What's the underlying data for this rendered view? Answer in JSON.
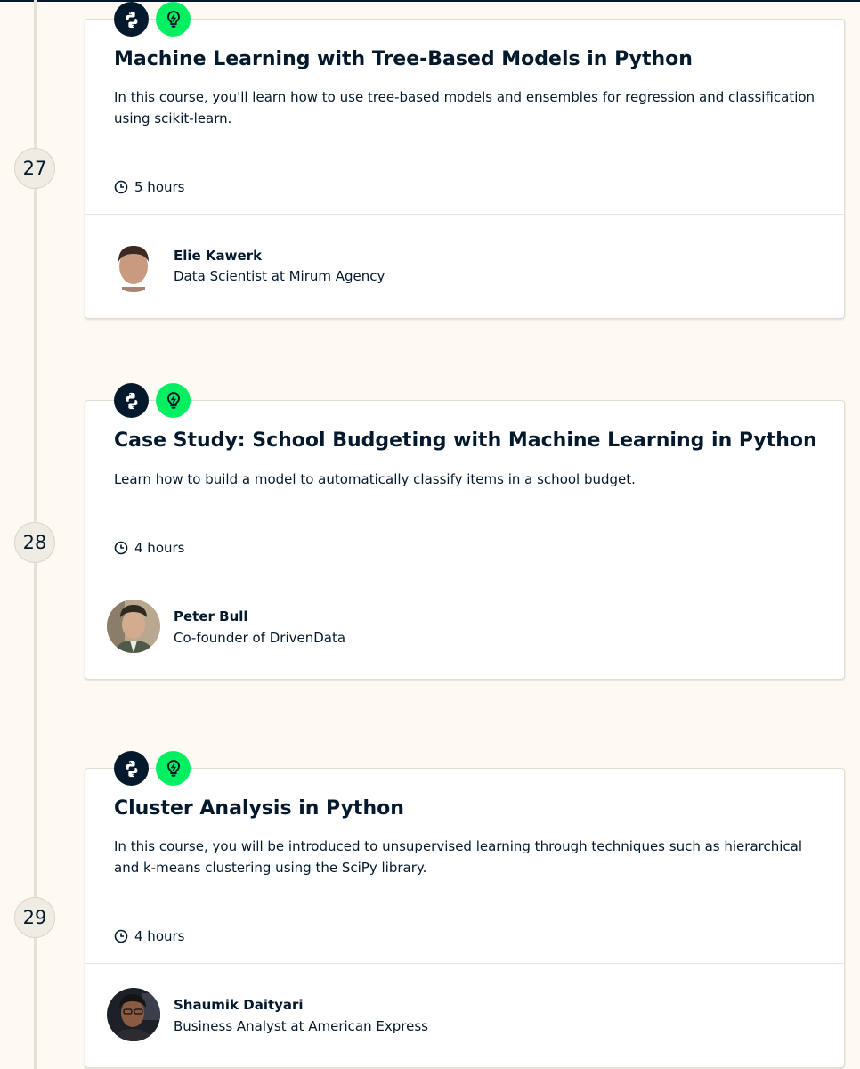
{
  "colors": {
    "background": "#fcfaf2",
    "navy": "#05192d",
    "brand_green": "#03ef62",
    "timeline": "#e6e2d6"
  },
  "courses": [
    {
      "step": "27",
      "tech_icon": "python-icon",
      "topic_icon": "lightbulb-icon",
      "title": "Machine Learning with Tree-Based Models in Python",
      "description": "In this course, you'll learn how to use tree-based models and ensembles for regression and classification using scikit-learn.",
      "duration": "5 hours",
      "instructor": {
        "name": "Elie Kawerk",
        "role": "Data Scientist at Mirum Agency"
      }
    },
    {
      "step": "28",
      "tech_icon": "python-icon",
      "topic_icon": "lightbulb-icon",
      "title": "Case Study: School Budgeting with Machine Learning in Python",
      "description": "Learn how to build a model to automatically classify items in a school budget.",
      "duration": "4 hours",
      "instructor": {
        "name": "Peter Bull",
        "role": "Co-founder of DrivenData"
      }
    },
    {
      "step": "29",
      "tech_icon": "python-icon",
      "topic_icon": "lightbulb-icon",
      "title": "Cluster Analysis in Python",
      "description": "In this course, you will be introduced to unsupervised learning through techniques such as hierarchical and k-means clustering using the SciPy library.",
      "duration": "4 hours",
      "instructor": {
        "name": "Shaumik Daityari",
        "role": "Business Analyst at American Express"
      }
    }
  ]
}
